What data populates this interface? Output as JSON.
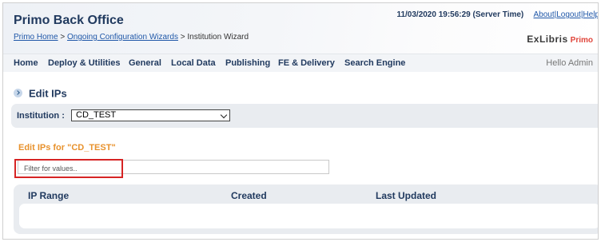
{
  "header": {
    "app_title": "Primo Back Office",
    "timestamp": "11/03/2020 19:56:29 (Server Time)",
    "links": {
      "about": "About|",
      "logout": "Logout|",
      "help": "Help"
    },
    "logo": {
      "brand": "ExLibris",
      "product": "Primo"
    }
  },
  "breadcrumb": {
    "home": "Primo Home",
    "sep1": " > ",
    "wizards": "Ongoing Configuration Wizards",
    "sep2": " > ",
    "current": "Institution Wizard"
  },
  "nav": {
    "items": [
      "Home",
      "Deploy & Utilities",
      "General",
      "Local Data",
      "Publishing",
      "FE & Delivery",
      "Search Engine"
    ],
    "greeting": "Hello Admin"
  },
  "section": {
    "title": "Edit IPs",
    "icon": "chevron-right-icon"
  },
  "institution": {
    "label": "Institution :",
    "selected": "CD_TEST"
  },
  "edit_for": "Edit IPs for \"CD_TEST\"",
  "filter": {
    "placeholder": "Filter for values.."
  },
  "table": {
    "columns": [
      "IP Range",
      "Created",
      "Last Updated"
    ]
  },
  "colors": {
    "title": "#213a5f",
    "accent": "#e8922d",
    "highlight": "#d62424",
    "link": "#1f57a8"
  }
}
